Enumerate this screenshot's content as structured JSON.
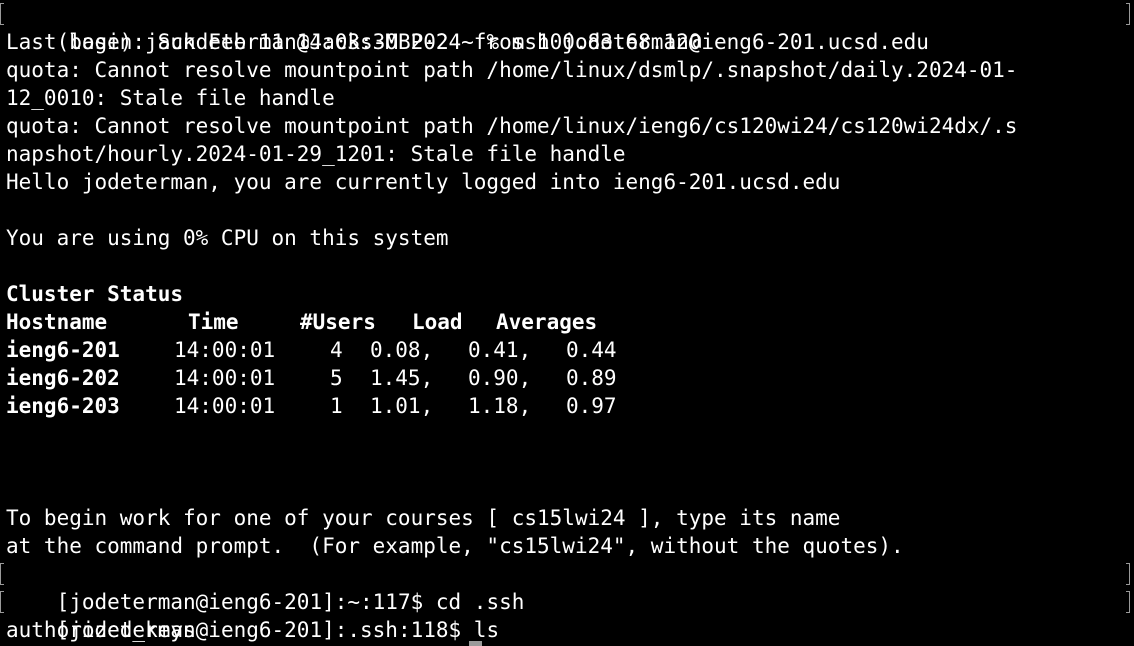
{
  "terminal": {
    "lines_before_status": [
      "(base) jackdeterman@Jacks-MBP-2 ~ % ssh jodeterman@ieng6-201.ucsd.edu",
      "Last login: Sun Feb 11 14:03:30 2024 from 100.83.68.120",
      "quota: Cannot resolve mountpoint path /home/linux/dsmlp/.snapshot/daily.2024-01-",
      "12_0010: Stale file handle",
      "quota: Cannot resolve mountpoint path /home/linux/ieng6/cs120wi24/cs120wi24dx/.s",
      "napshot/hourly.2024-01-29_1201: Stale file handle",
      "Hello jodeterman, you are currently logged into ieng6-201.ucsd.edu",
      "",
      "You are using 0% CPU on this system",
      ""
    ],
    "cluster_status": {
      "title": "Cluster Status",
      "headers": {
        "hostname": "Hostname",
        "time": "Time",
        "users": "#Users",
        "load": "Load",
        "averages": "Averages"
      },
      "rows": [
        {
          "host": "ieng6-201",
          "time": "14:00:01",
          "users": "4",
          "load1": "0.08,",
          "load5": "0.41,",
          "load15": "0.44"
        },
        {
          "host": "ieng6-202",
          "time": "14:00:01",
          "users": "5",
          "load1": "1.45,",
          "load5": "0.90,",
          "load15": "0.89"
        },
        {
          "host": "ieng6-203",
          "time": "14:00:01",
          "users": "1",
          "load1": "1.01,",
          "load5": "1.18,",
          "load15": "0.97"
        }
      ]
    },
    "message_lines": [
      "To begin work for one of your courses [ cs15lwi24 ], type its name",
      "at the command prompt.  (For example, \"cs15lwi24\", without the quotes)."
    ],
    "commands": [
      "[jodeterman@ieng6-201]:~:117$ cd .ssh",
      "[jodeterman@ieng6-201]:.ssh:118$ ls"
    ],
    "output": "authorized_keys"
  }
}
